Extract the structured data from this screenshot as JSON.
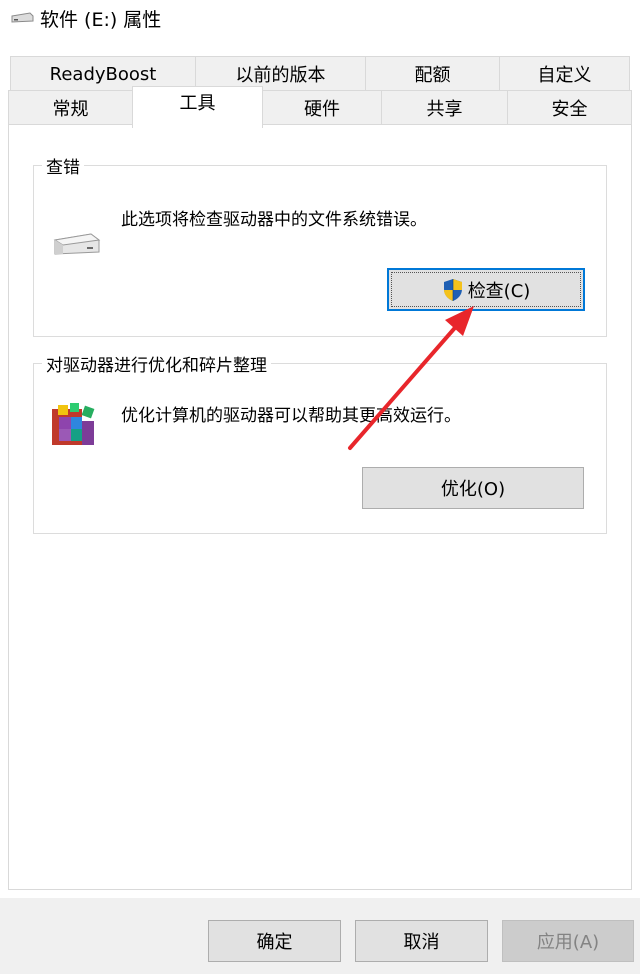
{
  "window": {
    "title": "软件 (E:) 属性",
    "title_icon": "drive-icon"
  },
  "tabs": {
    "row_back": [
      {
        "label": "ReadyBoost"
      },
      {
        "label": "以前的版本"
      },
      {
        "label": "配额"
      },
      {
        "label": "自定义"
      }
    ],
    "row_front": [
      {
        "label": "常规"
      },
      {
        "label": "工具",
        "selected": true
      },
      {
        "label": "硬件"
      },
      {
        "label": "共享"
      },
      {
        "label": "安全"
      }
    ]
  },
  "error_check": {
    "title": "查错",
    "description": "此选项将检查驱动器中的文件系统错误。",
    "button_label": "检查(C)",
    "icon": "drive-icon",
    "button_icon": "shield-icon"
  },
  "optimize": {
    "title": "对驱动器进行优化和碎片整理",
    "description": "优化计算机的驱动器可以帮助其更高效运行。",
    "button_label": "优化(O)",
    "icon": "defrag-icon"
  },
  "footer": {
    "ok_label": "确定",
    "cancel_label": "取消",
    "apply_label": "应用(A)"
  },
  "colors": {
    "annotation_arrow": "#e8262b",
    "focus_border": "#0078d7"
  }
}
